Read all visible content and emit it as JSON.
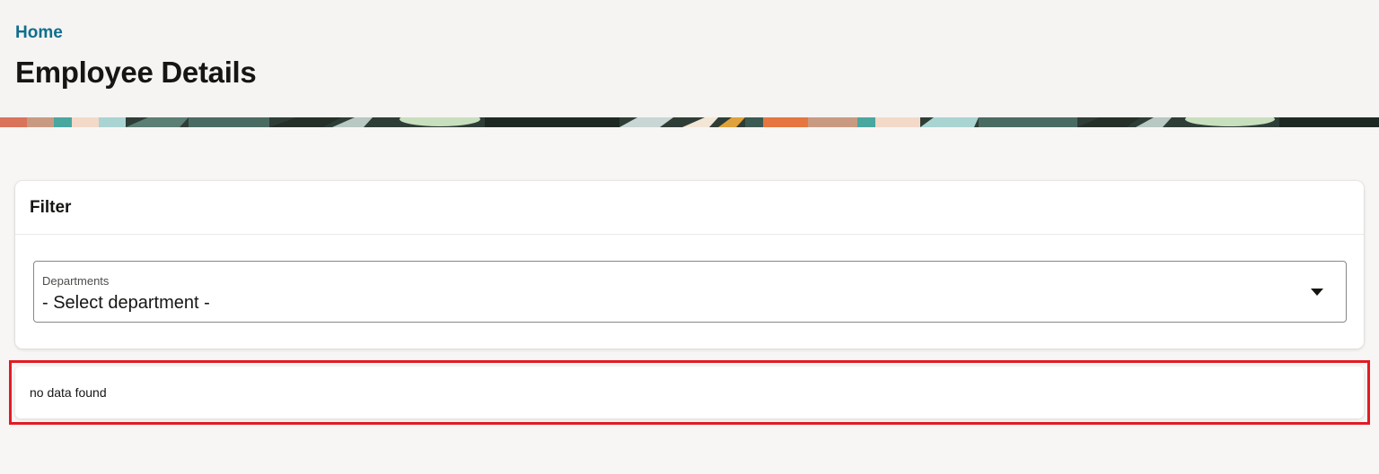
{
  "header": {
    "breadcrumb": "Home",
    "title": "Employee Details"
  },
  "filter": {
    "title": "Filter",
    "departments": {
      "label": "Departments",
      "value": "- Select department -",
      "icon": "caret-down-icon"
    }
  },
  "results": {
    "message": "no data found"
  },
  "colors": {
    "link": "#0f6e8e",
    "highlight_border": "#e21b23",
    "page_background": "#f8f6f4"
  }
}
